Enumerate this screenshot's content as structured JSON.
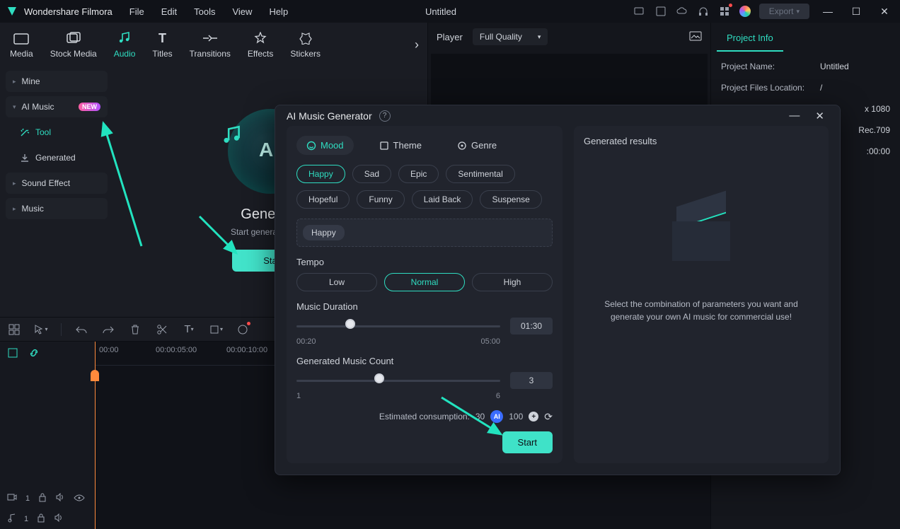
{
  "title_bar": {
    "app_name": "Wondershare Filmora",
    "menus": [
      "File",
      "Edit",
      "Tools",
      "View",
      "Help"
    ],
    "doc_title": "Untitled",
    "export_label": "Export"
  },
  "media_tabs": [
    "Media",
    "Stock Media",
    "Audio",
    "Titles",
    "Transitions",
    "Effects",
    "Stickers"
  ],
  "media_tabs_active_index": 2,
  "sidebar": {
    "mine": "Mine",
    "ai_music": "AI Music",
    "ai_music_badge": "NEW",
    "tool": "Tool",
    "generated": "Generated",
    "sound_effect": "Sound Effect",
    "music": "Music"
  },
  "generate_card": {
    "title": "Generate",
    "subtitle": "Start generating your",
    "button": "Sta"
  },
  "player": {
    "label": "Player",
    "quality": "Full Quality"
  },
  "project_info": {
    "tab": "Project Info",
    "rows": [
      {
        "k": "Project Name:",
        "v": "Untitled"
      },
      {
        "k": "Project Files Location:",
        "v": "/"
      },
      {
        "k": "",
        "v": "x 1080"
      },
      {
        "k": "",
        "v": "Rec.709"
      },
      {
        "k": "",
        "v": ":00:00"
      }
    ]
  },
  "timeline": {
    "timestamps": [
      "00:00",
      "00:00:05:00",
      "00:00:10:00"
    ]
  },
  "modal": {
    "title": "AI Music Generator",
    "tabs": {
      "mood": "Mood",
      "theme": "Theme",
      "genre": "Genre"
    },
    "moods_row1": [
      "Happy",
      "Sad",
      "Epic",
      "Sentimental"
    ],
    "moods_row2": [
      "Hopeful",
      "Funny",
      "Laid Back",
      "Suspense"
    ],
    "mood_selected": "Happy",
    "tempo_label": "Tempo",
    "tempo_opts": [
      "Low",
      "Normal",
      "High"
    ],
    "tempo_selected": "Normal",
    "duration_label": "Music Duration",
    "duration_min": "00:20",
    "duration_max": "05:00",
    "duration_val": "01:30",
    "count_label": "Generated Music Count",
    "count_min": "1",
    "count_max": "6",
    "count_val": "3",
    "estimated_label": "Estimated consumption:",
    "estimated_cost": "30",
    "estimated_balance": "100",
    "start": "Start",
    "results_label": "Generated results",
    "results_hint": "Select the combination of parameters you want and generate your own AI music for commercial use!"
  }
}
